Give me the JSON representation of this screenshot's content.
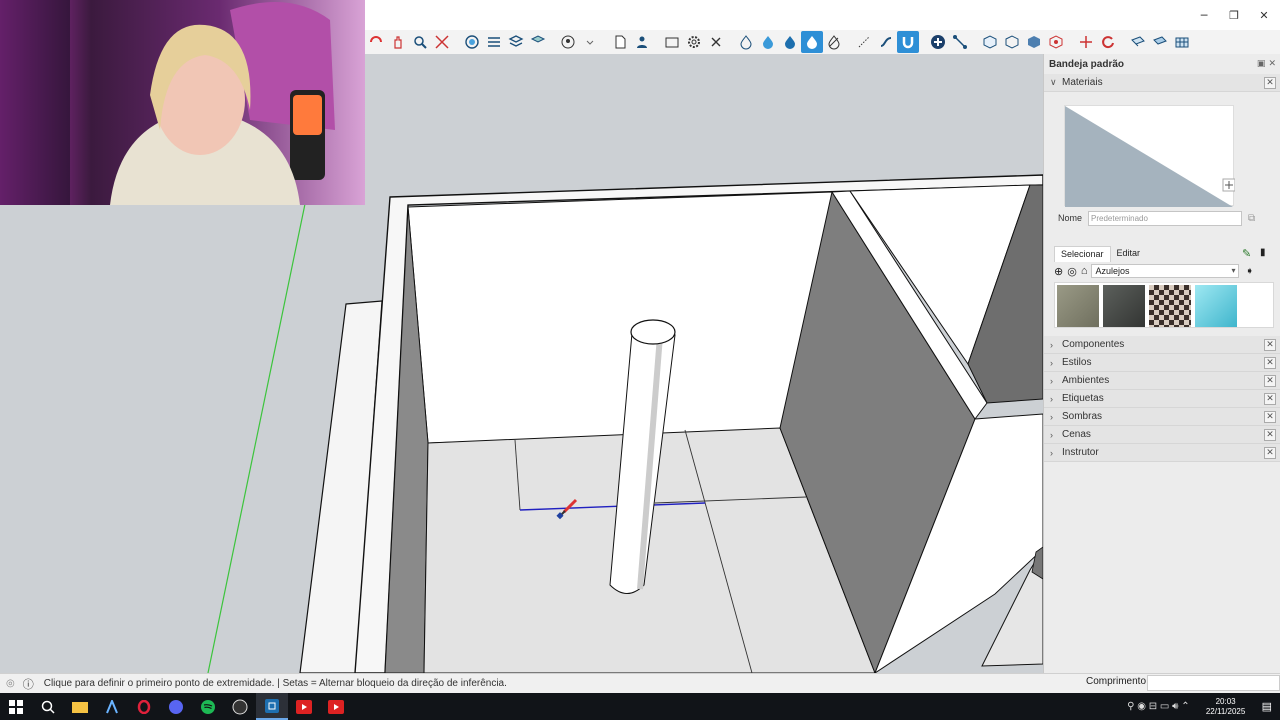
{
  "window": {
    "minimize": "─",
    "maximize": "❐",
    "close": "✕"
  },
  "toolbar": {
    "icons": [
      "orbit-icon",
      "pan-icon",
      "zoom-icon",
      "zoom-extents-icon",
      "xray-icon",
      "back-edges-icon",
      "wireframe-icon",
      "hidden-line-icon",
      "shaded-icon",
      "textures-icon",
      "monochrome-icon",
      "section-icon",
      "new-file-icon",
      "user-icon",
      "rectangle-icon",
      "settings-icon",
      "close-x-icon",
      "sandbox-icon",
      "drape-icon",
      "stamp-icon",
      "paint-bucket-icon",
      "eraser-icon",
      "measure-icon",
      "follow-me-icon",
      "magnet-icon",
      "add-icon",
      "line-icon",
      "box-icon",
      "cube-icon",
      "hexagon-icon",
      "target-icon",
      "axes-icon",
      "rotate-icon",
      "grid-icon",
      "terrain-icon",
      "mesh-icon"
    ]
  },
  "tray": {
    "title": "Bandeja padrão",
    "materials": {
      "title": "Materiais",
      "name_label": "Nome",
      "name_placeholder": "Predeterminado",
      "tab_select": "Selecionar",
      "tab_edit": "Editar",
      "library": "Azulejos",
      "swatch_colors": [
        "#8a8a76",
        "#4a4d4a",
        "#9b8c80",
        "#6fd0e0"
      ]
    },
    "panels": [
      {
        "label": "Componentes"
      },
      {
        "label": "Estilos"
      },
      {
        "label": "Ambientes"
      },
      {
        "label": "Etiquetas"
      },
      {
        "label": "Sombras"
      },
      {
        "label": "Cenas"
      },
      {
        "label": "Instrutor"
      }
    ]
  },
  "status": {
    "message": "Clique para definir o primeiro ponto de extremidade. | Setas = Alternar bloqueio da direção de inferência.",
    "measure_label": "Comprimento",
    "measure_value": ""
  },
  "taskbar": {
    "time": "20:03",
    "date": "22/11/2025"
  },
  "colors": {
    "accent": "#2e8fd6",
    "sky": "#ccd0d4",
    "green_axis": "#3cc43c",
    "blue_axis": "#2020c0"
  }
}
